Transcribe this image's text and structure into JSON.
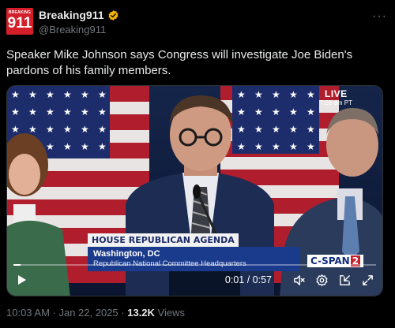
{
  "account": {
    "avatar_top_text": "BREAKING",
    "avatar_main_text": "911",
    "display_name": "Breaking911",
    "handle": "@Breaking911",
    "verified_badge_color": "#f4b400",
    "brand_color": "#d41f2a"
  },
  "menu": {
    "more_label": "···"
  },
  "tweet": {
    "text": "Speaker Mike Johnson says Congress will investigate Joe Biden's pardons of his family members."
  },
  "video": {
    "live_label": "LIVE",
    "live_time": "7:26 am PT",
    "lower_third_title": "HOUSE REPUBLICAN AGENDA",
    "lower_third_location": "Washington, DC",
    "lower_third_venue": "Republican National Committee Headquarters",
    "network_prefix": "C-SPAN",
    "network_number": "2",
    "time_readout": "0:01 / 0:57",
    "progress_fraction": 0.02,
    "icons": [
      "play-icon",
      "mute-icon",
      "settings-icon",
      "picture-in-picture-icon",
      "fullscreen-icon"
    ]
  },
  "footer": {
    "timestamp": "10:03 AM · Jan 22, 2025 · ",
    "views_count": "13.2K",
    "views_label": " Views"
  },
  "colors": {
    "background": "#000000",
    "text_primary": "#e7e9ea",
    "text_secondary": "#71767b",
    "lower_third_blue": "#1a3a8c",
    "cspan_red": "#c61f2b"
  }
}
